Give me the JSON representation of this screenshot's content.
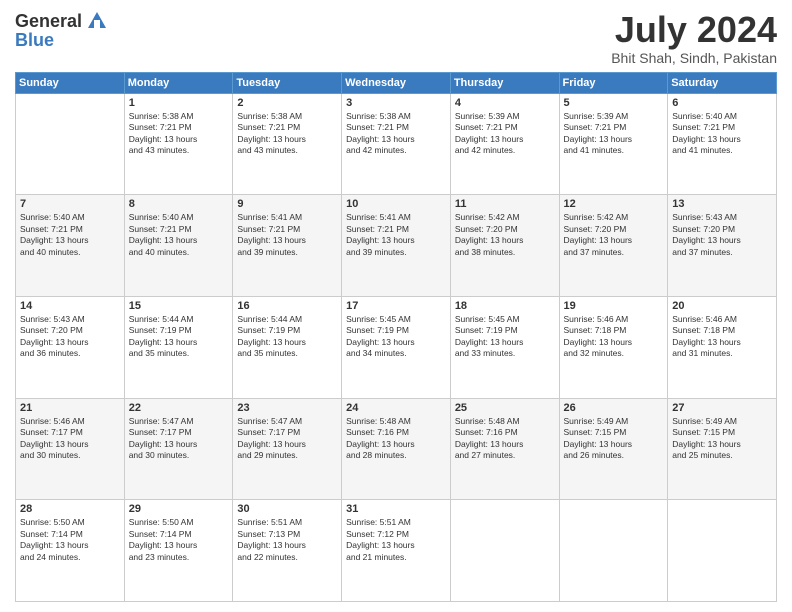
{
  "header": {
    "logo_general": "General",
    "logo_blue": "Blue",
    "title": "July 2024",
    "location": "Bhit Shah, Sindh, Pakistan"
  },
  "days_of_week": [
    "Sunday",
    "Monday",
    "Tuesday",
    "Wednesday",
    "Thursday",
    "Friday",
    "Saturday"
  ],
  "weeks": [
    [
      {
        "day": "",
        "info": ""
      },
      {
        "day": "1",
        "info": "Sunrise: 5:38 AM\nSunset: 7:21 PM\nDaylight: 13 hours\nand 43 minutes."
      },
      {
        "day": "2",
        "info": "Sunrise: 5:38 AM\nSunset: 7:21 PM\nDaylight: 13 hours\nand 43 minutes."
      },
      {
        "day": "3",
        "info": "Sunrise: 5:38 AM\nSunset: 7:21 PM\nDaylight: 13 hours\nand 42 minutes."
      },
      {
        "day": "4",
        "info": "Sunrise: 5:39 AM\nSunset: 7:21 PM\nDaylight: 13 hours\nand 42 minutes."
      },
      {
        "day": "5",
        "info": "Sunrise: 5:39 AM\nSunset: 7:21 PM\nDaylight: 13 hours\nand 41 minutes."
      },
      {
        "day": "6",
        "info": "Sunrise: 5:40 AM\nSunset: 7:21 PM\nDaylight: 13 hours\nand 41 minutes."
      }
    ],
    [
      {
        "day": "7",
        "info": "Sunrise: 5:40 AM\nSunset: 7:21 PM\nDaylight: 13 hours\nand 40 minutes."
      },
      {
        "day": "8",
        "info": "Sunrise: 5:40 AM\nSunset: 7:21 PM\nDaylight: 13 hours\nand 40 minutes."
      },
      {
        "day": "9",
        "info": "Sunrise: 5:41 AM\nSunset: 7:21 PM\nDaylight: 13 hours\nand 39 minutes."
      },
      {
        "day": "10",
        "info": "Sunrise: 5:41 AM\nSunset: 7:21 PM\nDaylight: 13 hours\nand 39 minutes."
      },
      {
        "day": "11",
        "info": "Sunrise: 5:42 AM\nSunset: 7:20 PM\nDaylight: 13 hours\nand 38 minutes."
      },
      {
        "day": "12",
        "info": "Sunrise: 5:42 AM\nSunset: 7:20 PM\nDaylight: 13 hours\nand 37 minutes."
      },
      {
        "day": "13",
        "info": "Sunrise: 5:43 AM\nSunset: 7:20 PM\nDaylight: 13 hours\nand 37 minutes."
      }
    ],
    [
      {
        "day": "14",
        "info": "Sunrise: 5:43 AM\nSunset: 7:20 PM\nDaylight: 13 hours\nand 36 minutes."
      },
      {
        "day": "15",
        "info": "Sunrise: 5:44 AM\nSunset: 7:19 PM\nDaylight: 13 hours\nand 35 minutes."
      },
      {
        "day": "16",
        "info": "Sunrise: 5:44 AM\nSunset: 7:19 PM\nDaylight: 13 hours\nand 35 minutes."
      },
      {
        "day": "17",
        "info": "Sunrise: 5:45 AM\nSunset: 7:19 PM\nDaylight: 13 hours\nand 34 minutes."
      },
      {
        "day": "18",
        "info": "Sunrise: 5:45 AM\nSunset: 7:19 PM\nDaylight: 13 hours\nand 33 minutes."
      },
      {
        "day": "19",
        "info": "Sunrise: 5:46 AM\nSunset: 7:18 PM\nDaylight: 13 hours\nand 32 minutes."
      },
      {
        "day": "20",
        "info": "Sunrise: 5:46 AM\nSunset: 7:18 PM\nDaylight: 13 hours\nand 31 minutes."
      }
    ],
    [
      {
        "day": "21",
        "info": "Sunrise: 5:46 AM\nSunset: 7:17 PM\nDaylight: 13 hours\nand 30 minutes."
      },
      {
        "day": "22",
        "info": "Sunrise: 5:47 AM\nSunset: 7:17 PM\nDaylight: 13 hours\nand 30 minutes."
      },
      {
        "day": "23",
        "info": "Sunrise: 5:47 AM\nSunset: 7:17 PM\nDaylight: 13 hours\nand 29 minutes."
      },
      {
        "day": "24",
        "info": "Sunrise: 5:48 AM\nSunset: 7:16 PM\nDaylight: 13 hours\nand 28 minutes."
      },
      {
        "day": "25",
        "info": "Sunrise: 5:48 AM\nSunset: 7:16 PM\nDaylight: 13 hours\nand 27 minutes."
      },
      {
        "day": "26",
        "info": "Sunrise: 5:49 AM\nSunset: 7:15 PM\nDaylight: 13 hours\nand 26 minutes."
      },
      {
        "day": "27",
        "info": "Sunrise: 5:49 AM\nSunset: 7:15 PM\nDaylight: 13 hours\nand 25 minutes."
      }
    ],
    [
      {
        "day": "28",
        "info": "Sunrise: 5:50 AM\nSunset: 7:14 PM\nDaylight: 13 hours\nand 24 minutes."
      },
      {
        "day": "29",
        "info": "Sunrise: 5:50 AM\nSunset: 7:14 PM\nDaylight: 13 hours\nand 23 minutes."
      },
      {
        "day": "30",
        "info": "Sunrise: 5:51 AM\nSunset: 7:13 PM\nDaylight: 13 hours\nand 22 minutes."
      },
      {
        "day": "31",
        "info": "Sunrise: 5:51 AM\nSunset: 7:12 PM\nDaylight: 13 hours\nand 21 minutes."
      },
      {
        "day": "",
        "info": ""
      },
      {
        "day": "",
        "info": ""
      },
      {
        "day": "",
        "info": ""
      }
    ]
  ]
}
